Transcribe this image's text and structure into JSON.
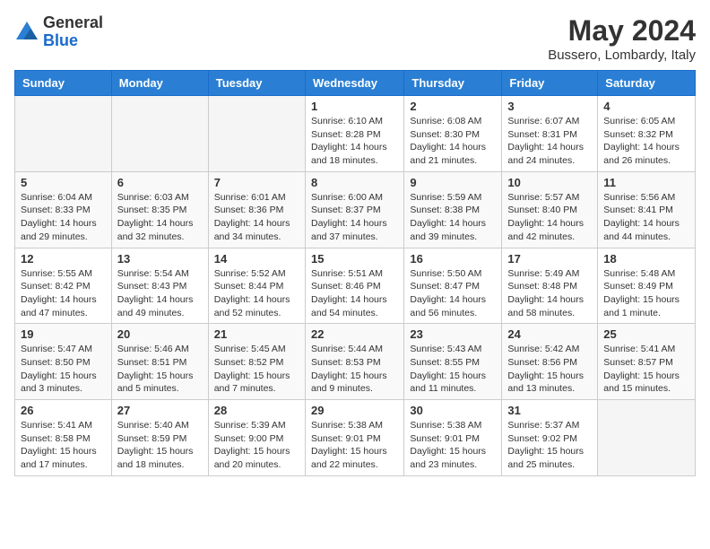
{
  "logo": {
    "general": "General",
    "blue": "Blue"
  },
  "title": "May 2024",
  "location": "Bussero, Lombardy, Italy",
  "headers": [
    "Sunday",
    "Monday",
    "Tuesday",
    "Wednesday",
    "Thursday",
    "Friday",
    "Saturday"
  ],
  "weeks": [
    [
      {
        "day": "",
        "info": ""
      },
      {
        "day": "",
        "info": ""
      },
      {
        "day": "",
        "info": ""
      },
      {
        "day": "1",
        "info": "Sunrise: 6:10 AM\nSunset: 8:28 PM\nDaylight: 14 hours\nand 18 minutes."
      },
      {
        "day": "2",
        "info": "Sunrise: 6:08 AM\nSunset: 8:30 PM\nDaylight: 14 hours\nand 21 minutes."
      },
      {
        "day": "3",
        "info": "Sunrise: 6:07 AM\nSunset: 8:31 PM\nDaylight: 14 hours\nand 24 minutes."
      },
      {
        "day": "4",
        "info": "Sunrise: 6:05 AM\nSunset: 8:32 PM\nDaylight: 14 hours\nand 26 minutes."
      }
    ],
    [
      {
        "day": "5",
        "info": "Sunrise: 6:04 AM\nSunset: 8:33 PM\nDaylight: 14 hours\nand 29 minutes."
      },
      {
        "day": "6",
        "info": "Sunrise: 6:03 AM\nSunset: 8:35 PM\nDaylight: 14 hours\nand 32 minutes."
      },
      {
        "day": "7",
        "info": "Sunrise: 6:01 AM\nSunset: 8:36 PM\nDaylight: 14 hours\nand 34 minutes."
      },
      {
        "day": "8",
        "info": "Sunrise: 6:00 AM\nSunset: 8:37 PM\nDaylight: 14 hours\nand 37 minutes."
      },
      {
        "day": "9",
        "info": "Sunrise: 5:59 AM\nSunset: 8:38 PM\nDaylight: 14 hours\nand 39 minutes."
      },
      {
        "day": "10",
        "info": "Sunrise: 5:57 AM\nSunset: 8:40 PM\nDaylight: 14 hours\nand 42 minutes."
      },
      {
        "day": "11",
        "info": "Sunrise: 5:56 AM\nSunset: 8:41 PM\nDaylight: 14 hours\nand 44 minutes."
      }
    ],
    [
      {
        "day": "12",
        "info": "Sunrise: 5:55 AM\nSunset: 8:42 PM\nDaylight: 14 hours\nand 47 minutes."
      },
      {
        "day": "13",
        "info": "Sunrise: 5:54 AM\nSunset: 8:43 PM\nDaylight: 14 hours\nand 49 minutes."
      },
      {
        "day": "14",
        "info": "Sunrise: 5:52 AM\nSunset: 8:44 PM\nDaylight: 14 hours\nand 52 minutes."
      },
      {
        "day": "15",
        "info": "Sunrise: 5:51 AM\nSunset: 8:46 PM\nDaylight: 14 hours\nand 54 minutes."
      },
      {
        "day": "16",
        "info": "Sunrise: 5:50 AM\nSunset: 8:47 PM\nDaylight: 14 hours\nand 56 minutes."
      },
      {
        "day": "17",
        "info": "Sunrise: 5:49 AM\nSunset: 8:48 PM\nDaylight: 14 hours\nand 58 minutes."
      },
      {
        "day": "18",
        "info": "Sunrise: 5:48 AM\nSunset: 8:49 PM\nDaylight: 15 hours\nand 1 minute."
      }
    ],
    [
      {
        "day": "19",
        "info": "Sunrise: 5:47 AM\nSunset: 8:50 PM\nDaylight: 15 hours\nand 3 minutes."
      },
      {
        "day": "20",
        "info": "Sunrise: 5:46 AM\nSunset: 8:51 PM\nDaylight: 15 hours\nand 5 minutes."
      },
      {
        "day": "21",
        "info": "Sunrise: 5:45 AM\nSunset: 8:52 PM\nDaylight: 15 hours\nand 7 minutes."
      },
      {
        "day": "22",
        "info": "Sunrise: 5:44 AM\nSunset: 8:53 PM\nDaylight: 15 hours\nand 9 minutes."
      },
      {
        "day": "23",
        "info": "Sunrise: 5:43 AM\nSunset: 8:55 PM\nDaylight: 15 hours\nand 11 minutes."
      },
      {
        "day": "24",
        "info": "Sunrise: 5:42 AM\nSunset: 8:56 PM\nDaylight: 15 hours\nand 13 minutes."
      },
      {
        "day": "25",
        "info": "Sunrise: 5:41 AM\nSunset: 8:57 PM\nDaylight: 15 hours\nand 15 minutes."
      }
    ],
    [
      {
        "day": "26",
        "info": "Sunrise: 5:41 AM\nSunset: 8:58 PM\nDaylight: 15 hours\nand 17 minutes."
      },
      {
        "day": "27",
        "info": "Sunrise: 5:40 AM\nSunset: 8:59 PM\nDaylight: 15 hours\nand 18 minutes."
      },
      {
        "day": "28",
        "info": "Sunrise: 5:39 AM\nSunset: 9:00 PM\nDaylight: 15 hours\nand 20 minutes."
      },
      {
        "day": "29",
        "info": "Sunrise: 5:38 AM\nSunset: 9:01 PM\nDaylight: 15 hours\nand 22 minutes."
      },
      {
        "day": "30",
        "info": "Sunrise: 5:38 AM\nSunset: 9:01 PM\nDaylight: 15 hours\nand 23 minutes."
      },
      {
        "day": "31",
        "info": "Sunrise: 5:37 AM\nSunset: 9:02 PM\nDaylight: 15 hours\nand 25 minutes."
      },
      {
        "day": "",
        "info": ""
      }
    ]
  ]
}
